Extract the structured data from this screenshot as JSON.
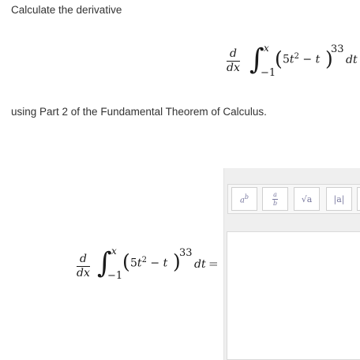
{
  "prompt": {
    "line1": "Calculate the derivative",
    "line2": "using Part 2 of the Fundamental Theorem of Calculus."
  },
  "math": {
    "d_num": "d",
    "d_den": "dx",
    "integral_sign": "∫",
    "upper_limit": "x",
    "lower_limit": "−1",
    "open_paren": "(",
    "close_paren": ")",
    "integrand_coef": "5",
    "integrand_var": "t",
    "integrand_pow": "2",
    "integrand_minus": " − ",
    "integrand_term": "t",
    "outer_exponent": "33",
    "differential": "dt",
    "equals": "="
  },
  "toolbar": {
    "power_label": "ab",
    "fraction_num": "a",
    "fraction_den": "b",
    "sqrt_label": "√a",
    "abs_label": "|a|"
  }
}
